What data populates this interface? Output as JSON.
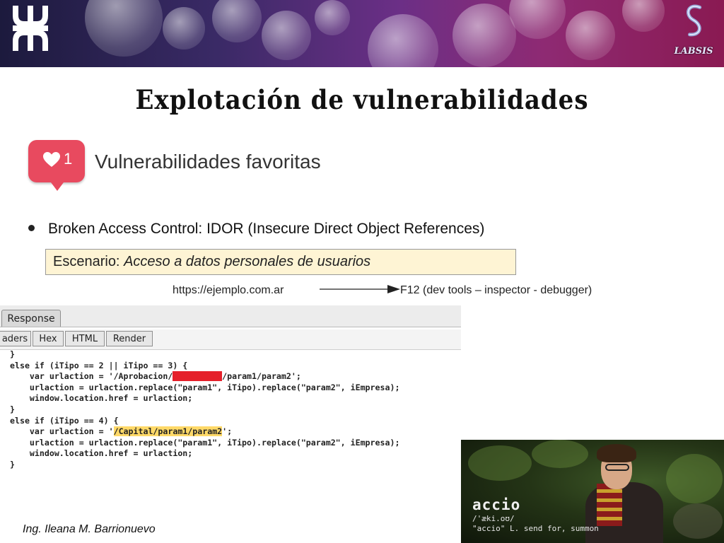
{
  "header": {
    "left_logo_icon": "utn-logo-icon",
    "right_logo_icon": "labsis-logo-icon",
    "right_logo_text": "LABSIS"
  },
  "slide": {
    "title": "Explotación de vulnerabilidades",
    "favorites": {
      "count": "1",
      "label": "Vulnerabilidades favoritas"
    },
    "bullet": "Broken Access Control: IDOR (Insecure Direct Object References)",
    "scenario": {
      "label": "Escenario:",
      "value": "Acceso a datos personales de usuarios"
    },
    "url": "https://ejemplo.com.ar",
    "devtools": "F12 (dev tools – inspector - debugger)"
  },
  "code_panel": {
    "tab": "Response",
    "subtabs": [
      "aders",
      "Hex",
      "HTML",
      "Render"
    ],
    "lines": {
      "l1": "}",
      "l2": "else if (iTipo == 2 || iTipo == 3) {",
      "l3a": "    var urlaction = '/Aprobacion/",
      "l3r": "XXXXXXXXXX",
      "l3b": "/param1/param2';",
      "l4": "    urlaction = urlaction.replace(\"param1\", iTipo).replace(\"param2\", iEmpresa);",
      "l5": "    window.location.href = urlaction;",
      "l6": "}",
      "l7": "else if (iTipo == 4) {",
      "l8a": "    var urlaction = '",
      "l8h": "/Capital/param1/param2",
      "l8b": "';",
      "l9": "    urlaction = urlaction.replace(\"param1\", iTipo).replace(\"param2\", iEmpresa);",
      "l10": "    window.location.href = urlaction;",
      "l11": "}"
    }
  },
  "accio": {
    "word": "accio",
    "phonetic": "/'æki.oʊ/",
    "definition": "\"accio\" L. send for, summon"
  },
  "footer": {
    "author": "Ing. Ileana M. Barrionuevo"
  }
}
